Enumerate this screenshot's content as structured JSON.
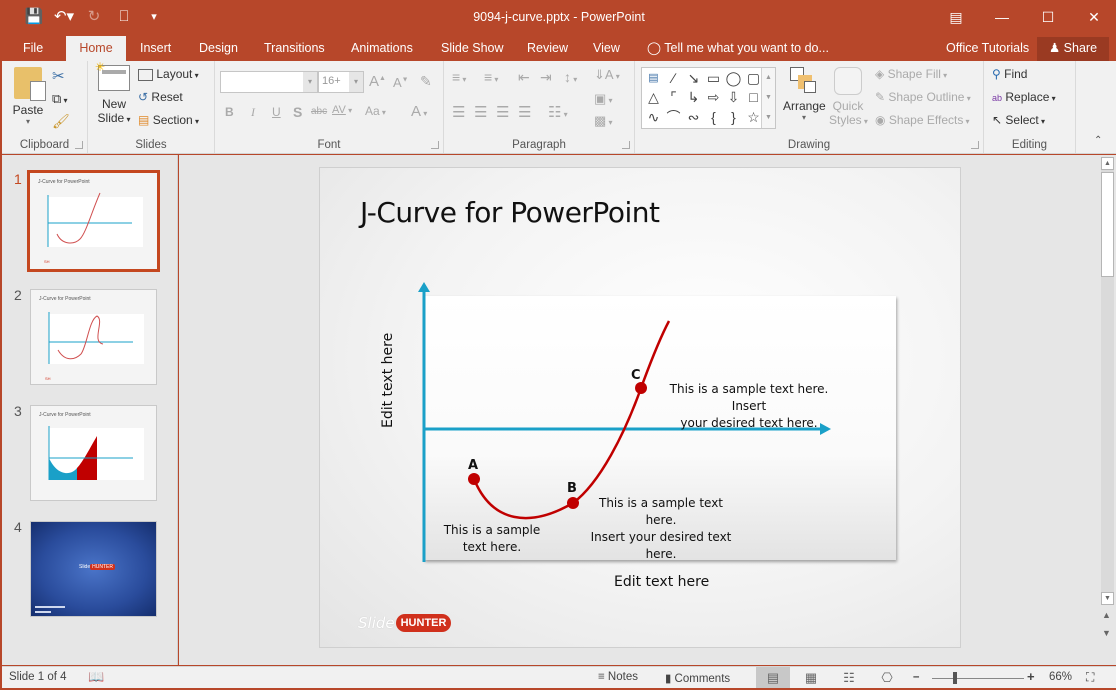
{
  "app": {
    "title": "9094-j-curve.pptx - PowerPoint",
    "quick_access": [
      "save-icon",
      "undo-icon",
      "redo-icon",
      "present-icon",
      "customize-icon"
    ],
    "window_controls": [
      "ribbon-display-icon",
      "minimize-icon",
      "maximize-icon",
      "close-icon"
    ]
  },
  "tabs": {
    "items": [
      "File",
      "Home",
      "Insert",
      "Design",
      "Transitions",
      "Animations",
      "Slide Show",
      "Review",
      "View"
    ],
    "active": "Home",
    "tell_me": "Tell me what you want to do...",
    "office_tutorials": "Office Tutorials",
    "share": "Share"
  },
  "ribbon": {
    "clipboard": {
      "label": "Clipboard",
      "paste": "Paste"
    },
    "slides": {
      "label": "Slides",
      "new_slide_1": "New",
      "new_slide_2": "Slide",
      "layout": "Layout",
      "reset": "Reset",
      "section": "Section"
    },
    "font": {
      "label": "Font",
      "font_name": "",
      "font_size": "16+",
      "bold": "B",
      "italic": "I",
      "underline": "U",
      "shadow": "S",
      "strike": "abc",
      "spacing": "AV",
      "case": "Aa",
      "color": "A",
      "grow": "A",
      "shrink": "A"
    },
    "paragraph": {
      "label": "Paragraph"
    },
    "drawing": {
      "label": "Drawing",
      "arrange": "Arrange",
      "quick_styles_1": "Quick",
      "quick_styles_2": "Styles",
      "shape_fill": "Shape Fill",
      "shape_outline": "Shape Outline",
      "shape_effects": "Shape Effects"
    },
    "editing": {
      "label": "Editing",
      "find": "Find",
      "replace": "Replace",
      "select": "Select"
    }
  },
  "thumbnails": [
    {
      "number": "1",
      "title": "J-Curve for PowerPoint",
      "selected": true
    },
    {
      "number": "2",
      "title": "J-Curve for PowerPoint",
      "selected": false
    },
    {
      "number": "3",
      "title": "J-Curve for PowerPoint",
      "selected": false
    },
    {
      "number": "4",
      "title": "",
      "selected": false
    }
  ],
  "slide": {
    "title": "J-Curve for PowerPoint",
    "y_axis_label": "Edit text here",
    "x_axis_label": "Edit text here",
    "points": {
      "A": {
        "label": "A",
        "text_1": "This is a sample",
        "text_2": "text here."
      },
      "B": {
        "label": "B",
        "text_1": "This is a sample text here.",
        "text_2": "Insert your desired text",
        "text_3": "here."
      },
      "C": {
        "label": "C",
        "text_1": "This is a sample text here. Insert",
        "text_2": "your desired text here."
      }
    },
    "logo_slide": "Slide",
    "logo_hunter": "HUNTER",
    "colors": {
      "axis": "#1aa0c8",
      "curve": "#c00000"
    }
  },
  "status": {
    "slide_info": "Slide 1 of 4",
    "notes": "Notes",
    "comments": "Comments",
    "zoom": "66%",
    "zoom_value_percent": 66
  }
}
